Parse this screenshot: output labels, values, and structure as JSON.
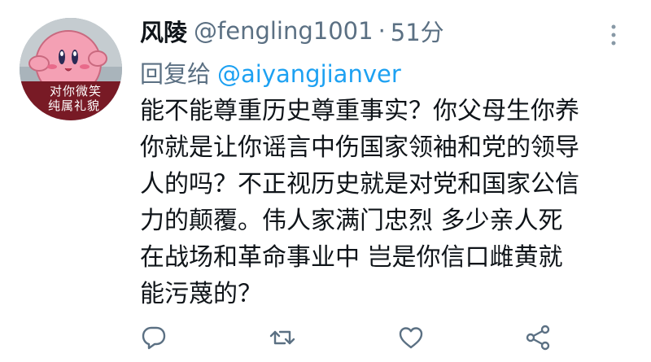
{
  "author": {
    "display_name": "风陵",
    "handle": "@fengling1001",
    "separator": "·",
    "timestamp": "51分",
    "avatar_caption_lines": [
      "对你微笑",
      "纯属礼貌"
    ]
  },
  "reply": {
    "prefix": "回复给",
    "to": "@aiyangjianver"
  },
  "tweet_lines": [
    "能不能尊重历史尊重事实？你父母生你养",
    "你就是让你谣言中伤国家领袖和党的领导",
    "人的吗？不正视历史就是对党和国家公信",
    "力的颠覆。伟人家满门忠烈  多少亲人死",
    "在战场和革命事业中 岂是你信口雌黄就",
    "能污蔑的？"
  ],
  "actions": [
    "reply-icon",
    "retweet-icon",
    "like-icon",
    "share-icon"
  ],
  "colors": {
    "text": "#0f1419",
    "muted": "#5b7083",
    "link": "#1da1f2",
    "avatar_bg": "#a9b4bb",
    "kirby_pink": "#f4a0b4"
  }
}
